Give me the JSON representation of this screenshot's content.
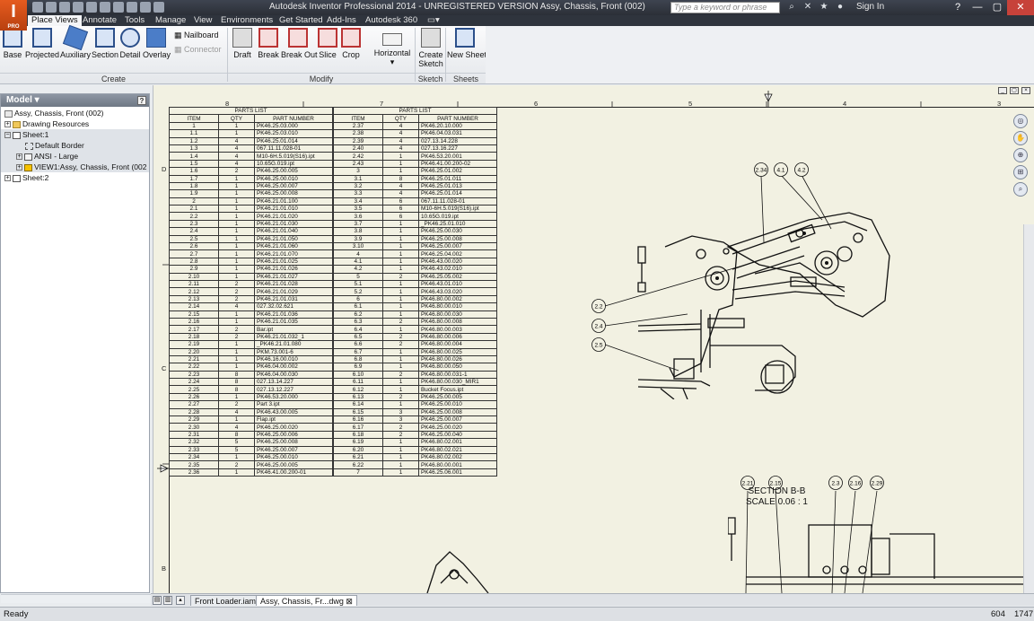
{
  "app": {
    "title": "Autodesk Inventor Professional 2014 - UNREGISTERED VERSION    Assy, Chassis, Front (002)",
    "logo_letter": "I",
    "logo_sub": "PRO",
    "search_placeholder": "Type a keyword or phrase",
    "sign_in": "Sign In"
  },
  "tabs": [
    {
      "label": "Place Views"
    },
    {
      "label": "Annotate"
    },
    {
      "label": "Tools"
    },
    {
      "label": "Manage"
    },
    {
      "label": "View"
    },
    {
      "label": "Environments"
    },
    {
      "label": "Get Started"
    },
    {
      "label": "Add-Ins"
    },
    {
      "label": "Autodesk 360"
    }
  ],
  "ribbon": {
    "create": {
      "base": "Base",
      "projected": "Projected",
      "auxiliary": "Auxiliary",
      "section": "Section",
      "detail": "Detail",
      "overlay": "Overlay",
      "nailboard": "Nailboard",
      "connector": "Connector",
      "label": "Create"
    },
    "modify": {
      "draft": "Draft",
      "break": "Break",
      "break_out": "Break Out",
      "slice": "Slice",
      "crop": "Crop",
      "horizontal": "Horizontal",
      "label": "Modify"
    },
    "sketch": {
      "create_sketch_1": "Create",
      "create_sketch_2": "Sketch",
      "label": "Sketch"
    },
    "sheets": {
      "new_sheet": "New Sheet",
      "label": "Sheets"
    }
  },
  "browser": {
    "title": "Model",
    "nodes": [
      {
        "label": "Assy, Chassis, Front (002)"
      },
      {
        "label": "Drawing Resources"
      },
      {
        "label": "Sheet:1"
      },
      {
        "label": "Default Border"
      },
      {
        "label": "ANSI - Large"
      },
      {
        "label": "VIEW1:Assy, Chassis, Front (002"
      },
      {
        "label": "Sheet:2"
      }
    ]
  },
  "drawing": {
    "zones_top": [
      "8",
      "7",
      "6",
      "5",
      "4",
      "3"
    ],
    "zones_left": [
      "D",
      "C",
      "B"
    ],
    "section_title": "SECTION B-B",
    "section_scale": "SCALE 0.06 : 1",
    "balloons_section": [
      "2.34",
      "4.1",
      "4.2",
      "2.2",
      "2.4",
      "2.5"
    ],
    "balloons_lower": [
      "2.21",
      "2.15",
      "2.3",
      "2.16",
      "2.29"
    ]
  },
  "parts_list": {
    "caption": "PARTS LIST",
    "headers": [
      "ITEM",
      "QTY",
      "PART NUMBER"
    ],
    "left": [
      [
        "1",
        "1",
        "PK46.25.03.000"
      ],
      [
        "1.1",
        "1",
        "PK46.25.03.010"
      ],
      [
        "1.2",
        "4",
        "PK46.25.01.014"
      ],
      [
        "1.3",
        "4",
        "067.11.11.028-01"
      ],
      [
        "1.4",
        "4",
        "M10-6H.5.019(S16).ipt"
      ],
      [
        "1.5",
        "4",
        "10.65G.019.ipt"
      ],
      [
        "1.6",
        "2",
        "PK46.25.00.005"
      ],
      [
        "1.7",
        "1",
        "PK46.25.00.010"
      ],
      [
        "1.8",
        "1",
        "PK46.25.00.007"
      ],
      [
        "1.9",
        "1",
        "PK46.25.00.008"
      ],
      [
        "2",
        "1",
        "PK46.21.01.100"
      ],
      [
        "2.1",
        "1",
        "PK46.21.01.010"
      ],
      [
        "2.2",
        "1",
        "PK46.21.01.020"
      ],
      [
        "2.3",
        "1",
        "PK46.21.01.030"
      ],
      [
        "2.4",
        "1",
        "PK46.21.01.040"
      ],
      [
        "2.5",
        "1",
        "PK46.21.01.050"
      ],
      [
        "2.6",
        "1",
        "PK46.21.01.060"
      ],
      [
        "2.7",
        "1",
        "PK46.21.01.070"
      ],
      [
        "2.8",
        "1",
        "PK46.21.01.025"
      ],
      [
        "2.9",
        "1",
        "PK46.21.01.026"
      ],
      [
        "2.10",
        "1",
        "PK46.21.01.027"
      ],
      [
        "2.11",
        "2",
        "PK46.21.01.028"
      ],
      [
        "2.12",
        "2",
        "PK46.21.01.029"
      ],
      [
        "2.13",
        "2",
        "PK46.21.01.031"
      ],
      [
        "2.14",
        "4",
        "027.32.02.621"
      ],
      [
        "2.15",
        "1",
        "PK46.21.01.036"
      ],
      [
        "2.16",
        "1",
        "PK46.21.01.035"
      ],
      [
        "2.17",
        "2",
        "Bar.ipt"
      ],
      [
        "2.18",
        "2",
        "PK46.21.01.032_1"
      ],
      [
        "2.19",
        "1",
        "_PK46.21.01.080"
      ],
      [
        "2.20",
        "1",
        "PKM.73.001-6"
      ],
      [
        "2.21",
        "1",
        "PK46.16.00.010"
      ],
      [
        "2.22",
        "1",
        "PK46.04.00.002"
      ],
      [
        "2.23",
        "8",
        "PK46.04.00.030"
      ],
      [
        "2.24",
        "8",
        "027.13.14.227"
      ],
      [
        "2.25",
        "8",
        "027.13.12.227"
      ],
      [
        "2.26",
        "1",
        "PK46.53.20.000"
      ],
      [
        "2.27",
        "2",
        "Part 3.ipt"
      ],
      [
        "2.28",
        "4",
        "PK46.43.00.005"
      ],
      [
        "2.29",
        "1",
        "Flap.ipt"
      ],
      [
        "2.30",
        "4",
        "PK46.25.00.020"
      ],
      [
        "2.31",
        "8",
        "PK46.25.00.006"
      ],
      [
        "2.32",
        "5",
        "PK46.25.00.008"
      ],
      [
        "2.33",
        "5",
        "PK46.25.00.007"
      ],
      [
        "2.34",
        "1",
        "PK46.25.00.010"
      ],
      [
        "2.35",
        "2",
        "PK46.25.00.005"
      ],
      [
        "2.36",
        "1",
        "PK46.41.00.200-01"
      ]
    ],
    "right": [
      [
        "2.37",
        "4",
        "PK46.20.10.000"
      ],
      [
        "2.38",
        "4",
        "PK46.04.03.031"
      ],
      [
        "2.39",
        "4",
        "027.13.14.228"
      ],
      [
        "2.40",
        "4",
        "027.13.16.227"
      ],
      [
        "2.42",
        "1",
        "PK46.53.20.001"
      ],
      [
        "2.43",
        "1",
        "PK46.41.00.200-02"
      ],
      [
        "3",
        "1",
        "PK46.25.01.002"
      ],
      [
        "3.1",
        "8",
        "PK46.25.01.011"
      ],
      [
        "3.2",
        "4",
        "PK46.25.01.013"
      ],
      [
        "3.3",
        "4",
        "PK46.25.01.014"
      ],
      [
        "3.4",
        "6",
        "067.11.11.028-01"
      ],
      [
        "3.5",
        "6",
        "M10-6H.5.019(S16).ipt"
      ],
      [
        "3.6",
        "6",
        "10.65G.019.ipt"
      ],
      [
        "3.7",
        "1",
        "_PK46.25.01.010"
      ],
      [
        "3.8",
        "1",
        "PK46.25.00.030"
      ],
      [
        "3.9",
        "1",
        "PK46.25.00.008"
      ],
      [
        "3.10",
        "1",
        "PK46.25.00.007"
      ],
      [
        "4",
        "1",
        "PK46.25.04.002"
      ],
      [
        "4.1",
        "1",
        "PK46.43.00.020"
      ],
      [
        "4.2",
        "1",
        "PK46.43.02.010"
      ],
      [
        "5",
        "2",
        "PK46.25.05.002"
      ],
      [
        "5.1",
        "1",
        "PK46.43.01.010"
      ],
      [
        "5.2",
        "1",
        "PK46.43.03.020"
      ],
      [
        "6",
        "1",
        "PK46.80.00.002"
      ],
      [
        "6.1",
        "1",
        "PK46.80.00.010"
      ],
      [
        "6.2",
        "1",
        "PK46.80.00.030"
      ],
      [
        "6.3",
        "2",
        "PK46.80.00.008"
      ],
      [
        "6.4",
        "1",
        "PK46.80.00.003"
      ],
      [
        "6.5",
        "2",
        "PK46.80.00.006"
      ],
      [
        "6.6",
        "2",
        "PK46.80.00.004"
      ],
      [
        "6.7",
        "1",
        "PK46.80.00.025"
      ],
      [
        "6.8",
        "1",
        "PK46.80.00.026"
      ],
      [
        "6.9",
        "1",
        "PK46.80.00.050"
      ],
      [
        "6.10",
        "2",
        "PK46.80.00.031-1"
      ],
      [
        "6.11",
        "1",
        "PK46.80.00.030_MIR1"
      ],
      [
        "6.12",
        "1",
        "Bucket Focus.ipt"
      ],
      [
        "6.13",
        "2",
        "PK46.25.00.005"
      ],
      [
        "6.14",
        "1",
        "PK46.25.00.010"
      ],
      [
        "6.15",
        "3",
        "PK46.25.00.008"
      ],
      [
        "6.16",
        "3",
        "PK46.25.00.007"
      ],
      [
        "6.17",
        "2",
        "PK46.25.00.020"
      ],
      [
        "6.18",
        "2",
        "PK46.25.00.040"
      ],
      [
        "6.19",
        "1",
        "PK46.80.02.001"
      ],
      [
        "6.20",
        "1",
        "PK46.80.02.021"
      ],
      [
        "6.21",
        "1",
        "PK46.80.02.002"
      ],
      [
        "6.22",
        "1",
        "PK46.80.00.001"
      ],
      [
        "7",
        "1",
        "PK46.25.06.001"
      ]
    ]
  },
  "doc_tabs": [
    {
      "label": "Front Loader.iam"
    },
    {
      "label": "Assy, Chassis, Fr...dwg"
    }
  ],
  "status": {
    "text": "Ready",
    "value1": "604",
    "value2": "1747"
  }
}
